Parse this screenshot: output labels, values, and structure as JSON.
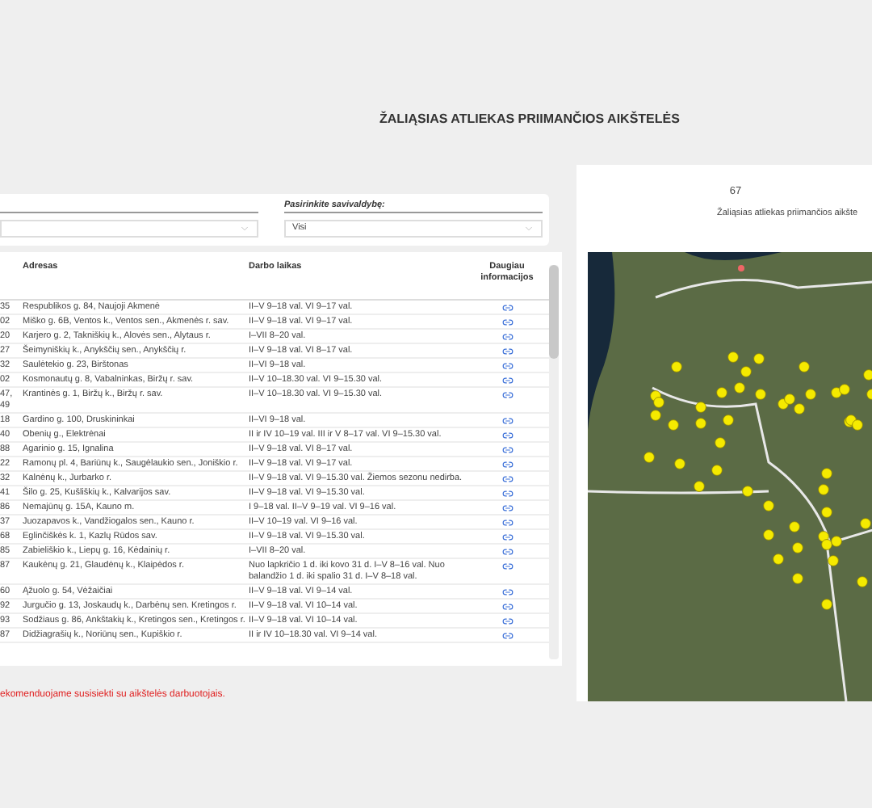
{
  "title": "ŽALIĄSIAS ATLIEKAS PRIIMANČIOS AIKŠTELĖS",
  "municipality_filter": {
    "label": "Pasirinkite savivaldybę:",
    "value": "Visi"
  },
  "table": {
    "columns": [
      "",
      "Adresas",
      "Darbo laikas",
      "Daugiau informacijos"
    ],
    "rows": [
      {
        "column_1": "35",
        "address": "Respublikos g. 84, Naujoji Akmenė",
        "hours": "II–V 9–18 val. VI 9–17 val."
      },
      {
        "column_1": "02",
        "address": "Miško g. 6B, Ventos k., Ventos sen., Akmenės r. sav.",
        "hours": "II–V 9–18 val. VI 9–17 val."
      },
      {
        "column_1": "20",
        "address": "Karjero g. 2, Takniškių k., Alovės sen., Alytaus r.",
        "hours": "I–VII 8–20 val."
      },
      {
        "column_1": "27",
        "address": "Šeimyniškių k., Anykščių sen., Anykščių r.",
        "hours": "II–V 9–18 val. VI 8–17 val."
      },
      {
        "column_1": "32",
        "address": "Saulėtekio g. 23, Birštonas",
        "hours": "II–VI 9–18 val."
      },
      {
        "column_1": "02",
        "address": "Kosmonautų g. 8, Vabalninkas, Biržų r. sav.",
        "hours": "II–V 10–18.30 val. VI 9–15.30 val."
      },
      {
        "column_1": "47, 49",
        "address": "Krantinės g. 1, Biržų k., Biržų r. sav.",
        "hours": "II–V 10–18.30 val. VI 9–15.30 val."
      },
      {
        "column_1": "18",
        "address": "Gardino g. 100, Druskininkai",
        "hours": "II–VI 9–18 val."
      },
      {
        "column_1": "40",
        "address": "Obenių g., Elektrėnai",
        "hours": "II ir IV 10–19 val. III ir V 8–17 val. VI 9–15.30 val."
      },
      {
        "column_1": "88",
        "address": "Agarinio g. 15, Ignalina",
        "hours": "II–V 9–18 val. VI 8–17 val."
      },
      {
        "column_1": "22",
        "address": "Ramonų pl. 4, Bariūnų k., Saugėlaukio sen., Joniškio r.",
        "hours": "II–V 9–18 val. VI 9–17 val."
      },
      {
        "column_1": "32",
        "address": "Kalnėnų k., Jurbarko r.",
        "hours": "II–V 9–18 val. VI 9–15.30 val. Žiemos sezonu nedirba."
      },
      {
        "column_1": "41",
        "address": "Šilo g. 25, Kušliškių k., Kalvarijos sav.",
        "hours": "II–V 9–18 val. VI 9–15.30 val."
      },
      {
        "column_1": "86",
        "address": "Nemajūnų g. 15A, Kauno m.",
        "hours": "I 9–18 val. II–V 9–19 val. VI 9–16 val."
      },
      {
        "column_1": "37",
        "address": "Juozapavos k., Vandžiogalos sen., Kauno r.",
        "hours": "II–V 10–19 val. VI 9–16 val."
      },
      {
        "column_1": "68",
        "address": "Eglinčiškės k. 1, Kazlų Rūdos sav.",
        "hours": "II–V 9–18 val. VI 9–15.30 val."
      },
      {
        "column_1": "85",
        "address": "Zabieliškio k., Liepų g. 16, Kėdainių r.",
        "hours": "I–VII 8–20 val."
      },
      {
        "column_1": "87",
        "address": "Kaukėnų g. 21, Glaudėnų k., Klaipėdos r.",
        "hours": "Nuo lapkričio 1 d. iki kovo 31 d. I–V 8–16 val. Nuo balandžio 1 d. iki spalio 31 d. I–V 8–18 val."
      },
      {
        "column_1": "60",
        "address": "Ąžuolo g. 54, Vėžaičiai",
        "hours": "II–V 9–18 val. VI 9–14 val."
      },
      {
        "column_1": "92",
        "address": "Jurgučio g. 13, Joskaudų k., Darbėnų sen. Kretingos r.",
        "hours": "II–V 9–18 val. VI 10–14 val."
      },
      {
        "column_1": "93",
        "address": "Sodžiaus g. 86, Ankštakių k., Kretingos sen., Kretingos r.",
        "hours": "II–V 9–18 val. VI 10–14 val."
      },
      {
        "column_1": "87",
        "address": "Didžiagrašių k., Noriūnų sen., Kupiškio r.",
        "hours": "II ir IV 10–18.30 val. VI 9–14 val."
      }
    ]
  },
  "summary": {
    "count": "67",
    "caption": "Žaliąsias atliekas priimančios aikšte"
  },
  "note": "ekomenduojame susisiekti su aikštelės darbuotojais."
}
